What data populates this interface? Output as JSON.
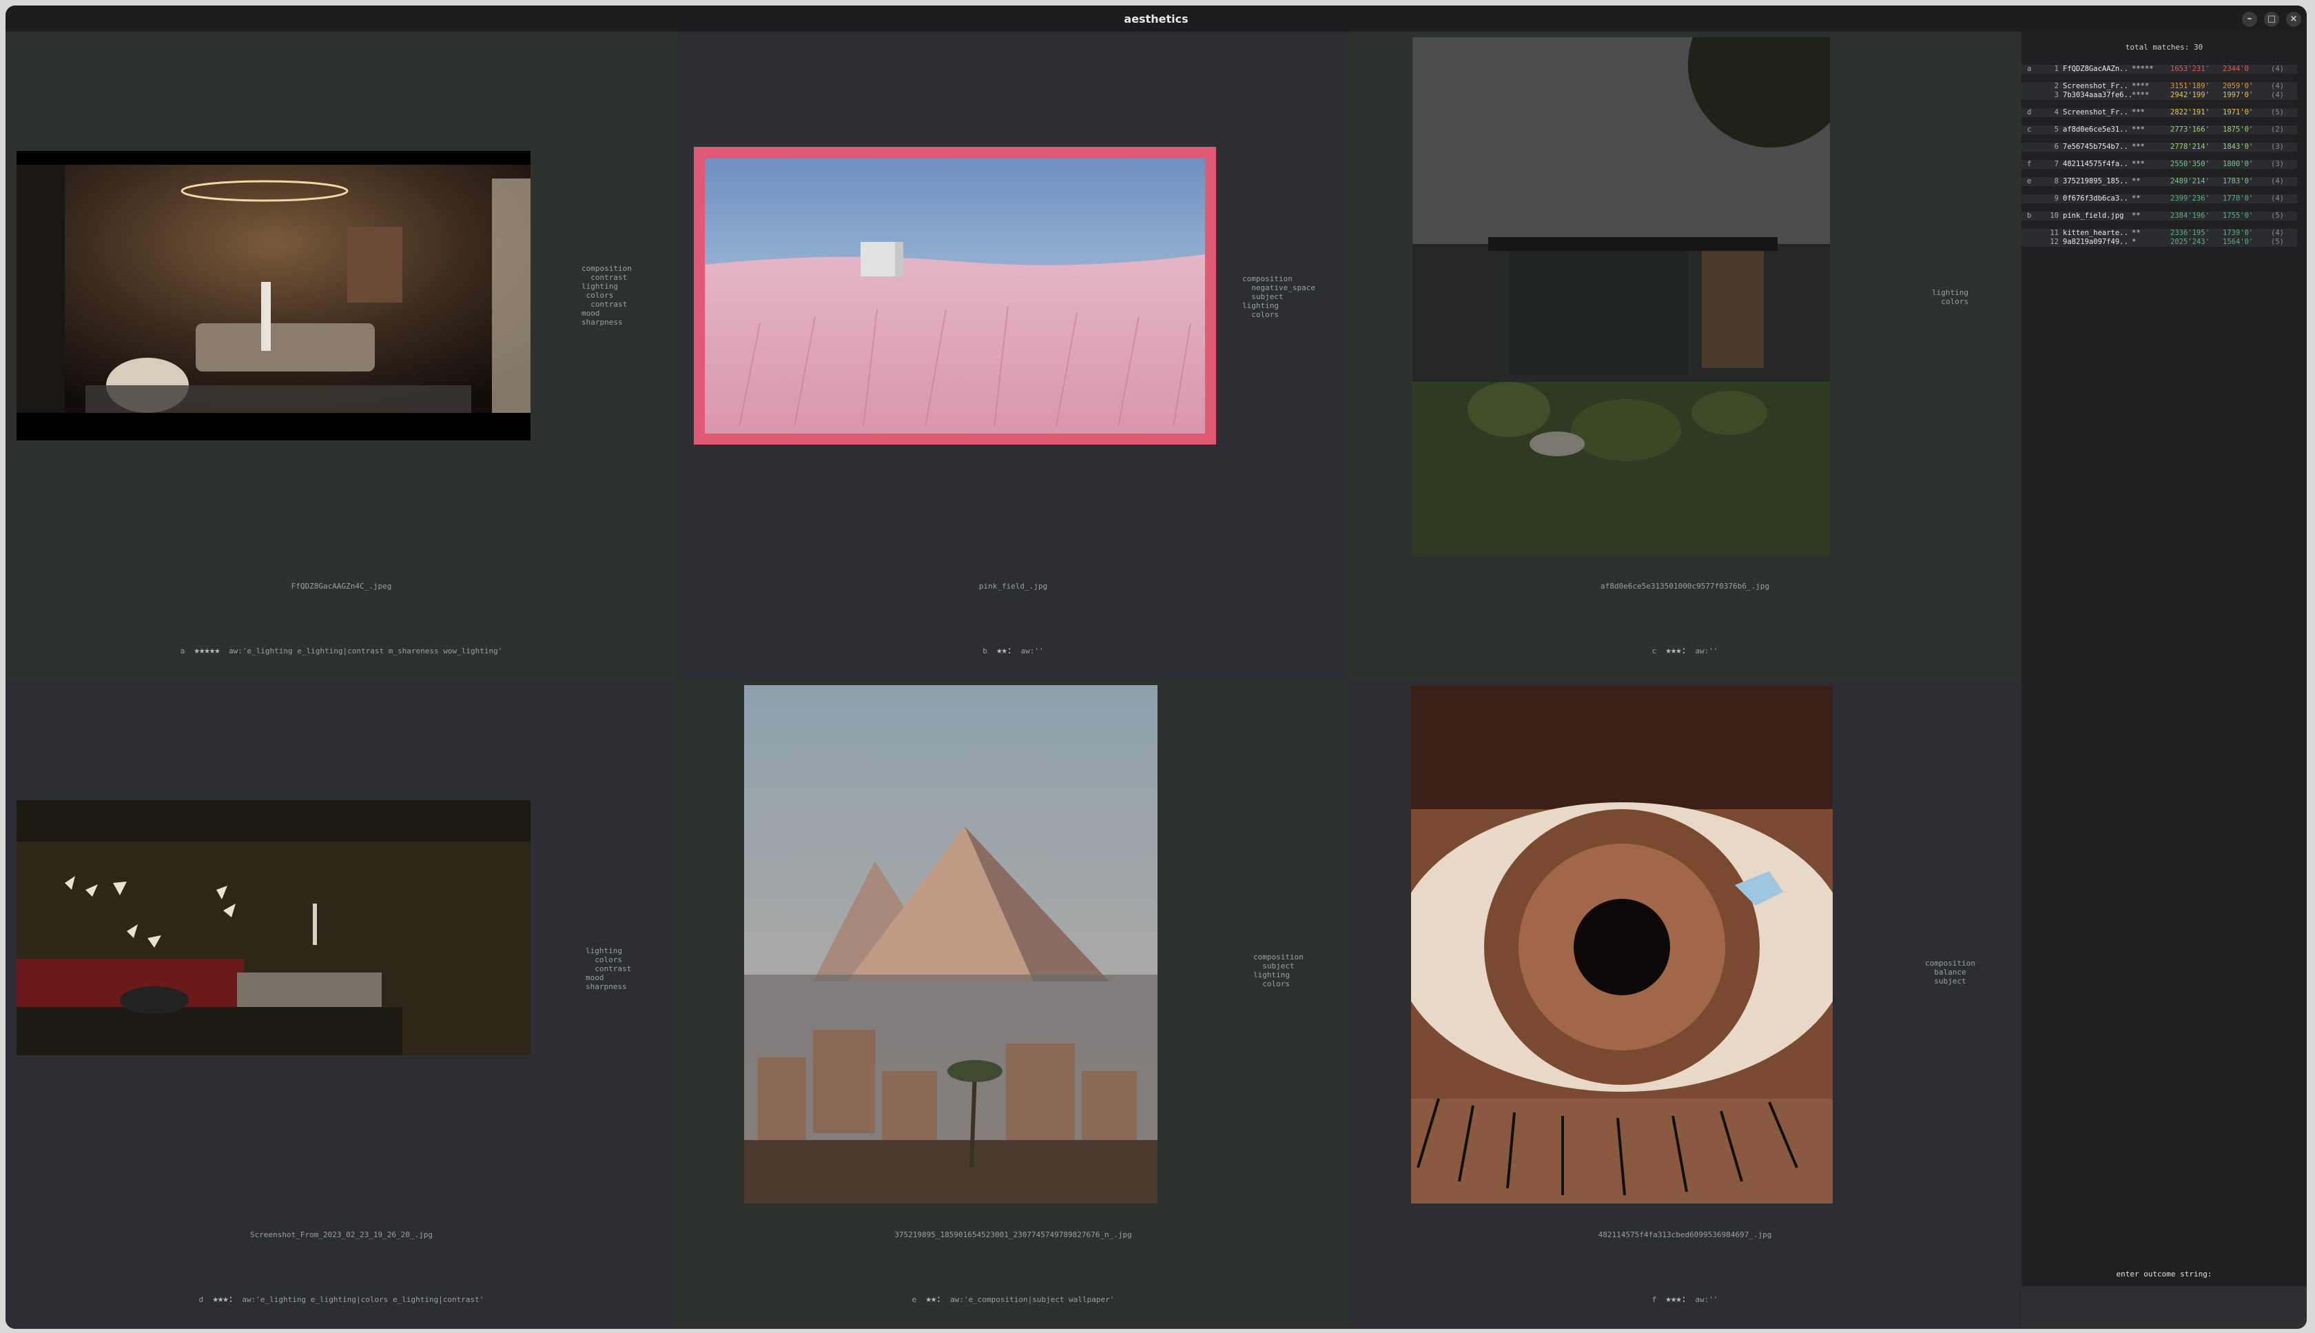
{
  "window": {
    "title": "aesthetics",
    "buttons": [
      "–",
      "□",
      "×"
    ]
  },
  "cells": [
    {
      "filename": "FfQDZ8GacAAGZn4C_.jpeg",
      "key": "a",
      "stars": "★★★★★",
      "stars_count": 5,
      "aw": "aw:'e_lighting e_lighting|contrast m_shareness wow_lighting'",
      "tags": "composition\n  contrast\nlighting\n colors\n  contrast\nmood\nsharpness"
    },
    {
      "filename": "pink_field_.jpg",
      "key": "b",
      "stars": "★★:",
      "stars_count": 2,
      "aw": "aw:''",
      "tags": "composition\n  negative_space\n  subject\nlighting\n  colors",
      "selected": true
    },
    {
      "filename": "af8d0e6ce5e313501000c9577f0376b6_.jpg",
      "key": "c",
      "stars": "★★★:",
      "stars_count": 3,
      "aw": "aw:''",
      "tags": "lighting\n  colors"
    },
    {
      "filename": "Screenshot_From_2023_02_23_19_26_20_.jpg",
      "key": "d",
      "stars": "★★★:",
      "stars_count": 3,
      "aw": "aw:'e_lighting e_lighting|colors e_lighting|contrast'",
      "tags": "lighting\n  colors\n  contrast\nmood\nsharpness"
    },
    {
      "filename": "375219895_185901654523001_2307745749789827676_n_.jpg",
      "key": "e",
      "stars": "★★:",
      "stars_count": 2,
      "aw": "aw:'e_composition|subject wallpaper'",
      "tags": "composition\n  subject\nlighting\n  colors"
    },
    {
      "filename": "482114575f4fa313cbed6099536984697_.jpg",
      "key": "f",
      "stars": "★★★:",
      "stars_count": 3,
      "aw": "aw:''",
      "tags": "composition\n  balance\n  subject"
    }
  ],
  "panel": {
    "total": "total matches: 30",
    "rows": [
      {
        "key": "a",
        "num": "1",
        "name": "FfQDZ8GacAAZn..",
        "stars": "*****",
        "s1": "1653'231'",
        "s1c": "#e05a5a",
        "s2": "2344'0",
        "s2c": "#e05a5a",
        "cnt": "(4)",
        "gap_after": true
      },
      {
        "key": "",
        "num": "2",
        "name": "Screenshot_Fr..",
        "stars": "****",
        "s1": "3151'189'",
        "s1c": "#e0943c",
        "s2": "2059'0'",
        "s2c": "#e0943c",
        "cnt": "(4)"
      },
      {
        "key": "",
        "num": "3",
        "name": "7b3034aaa37fe6..",
        "stars": "****",
        "s1": "2942'199'",
        "s1c": "#e6c64a",
        "s2": "1997'0'",
        "s2c": "#e6c64a",
        "cnt": "(4)",
        "gap_after": true
      },
      {
        "key": "d",
        "num": "4",
        "name": "Screenshot_Fr..",
        "stars": "***",
        "s1": "2822'191'",
        "s1c": "#e6c64a",
        "s2": "1971'0'",
        "s2c": "#e6c64a",
        "cnt": "(5)",
        "gap_after": true
      },
      {
        "key": "c",
        "num": "5",
        "name": "af8d0e6ce5e31..",
        "stars": "***",
        "s1": "2773'166'",
        "s1c": "#a8c878",
        "s2": "1875'0'",
        "s2c": "#a8c878",
        "cnt": "(2)",
        "gap_after": true
      },
      {
        "key": "",
        "num": "6",
        "name": "7e56745b754b7..",
        "stars": "***",
        "s1": "2778'214'",
        "s1c": "#a8c878",
        "s2": "1843'0'",
        "s2c": "#a8c878",
        "cnt": "(3)",
        "gap_after": true
      },
      {
        "key": "f",
        "num": "7",
        "name": "482114575f4fa..",
        "stars": "***",
        "s1": "2550'350'",
        "s1c": "#7cc48a",
        "s2": "1800'0'",
        "s2c": "#7cc48a",
        "cnt": "(3)",
        "gap_after": true
      },
      {
        "key": "e",
        "num": "8",
        "name": "375219895_185..",
        "stars": "**",
        "s1": "2489'214'",
        "s1c": "#7cc48a",
        "s2": "1783'0'",
        "s2c": "#7cc48a",
        "cnt": "(4)",
        "gap_after": true
      },
      {
        "key": "",
        "num": "9",
        "name": "0f676f3db6ca3..",
        "stars": "**",
        "s1": "2399'236'",
        "s1c": "#58b08a",
        "s2": "1770'0'",
        "s2c": "#58b08a",
        "cnt": "(4)",
        "gap_after": true
      },
      {
        "key": "b",
        "num": "10",
        "name": "pink_field.jpg",
        "stars": "**",
        "s1": "2384'196'",
        "s1c": "#58b08a",
        "s2": "1755'0'",
        "s2c": "#58b08a",
        "cnt": "(5)",
        "gap_after": true
      },
      {
        "key": "",
        "num": "11",
        "name": "kitten_hearte..",
        "stars": "**",
        "s1": "2336'195'",
        "s1c": "#58b08a",
        "s2": "1739'0'",
        "s2c": "#58b08a",
        "cnt": "(4)"
      },
      {
        "key": "",
        "num": "12",
        "name": "9a8219a097f49..",
        "stars": "*",
        "s1": "2025'243'",
        "s1c": "#58b08a",
        "s2": "1564'0'",
        "s2c": "#58b08a",
        "cnt": "(5)"
      }
    ],
    "prompt": "enter outcome string:"
  }
}
